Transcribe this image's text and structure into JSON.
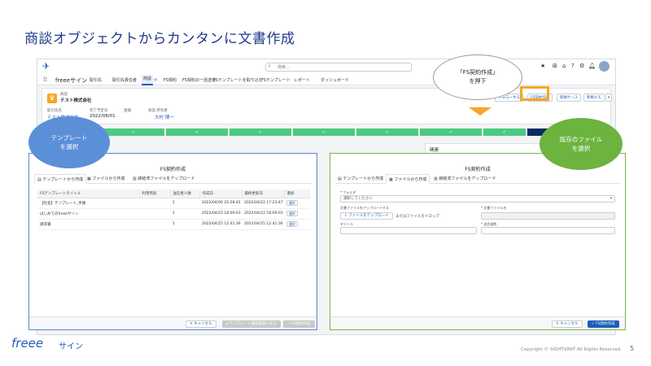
{
  "slide": {
    "title": "商談オブジェクトからカンタンに文書作成",
    "copyright": "Copyright © SIGHTVINIT All Rights Reserved.",
    "page_number": "5",
    "logo_text": "freee",
    "logo_sub": "サイン"
  },
  "topbar": {
    "app_name": "freeeサイン",
    "search_placeholder": "検索..."
  },
  "nav": {
    "tabs": [
      "取引先",
      "取引先責任者",
      "リード",
      "商談",
      "FS契約",
      "FS契約の一括送信",
      "FSテンプレートを取り込む",
      "FSテンプレート",
      "レポート",
      "ダッシュボード"
    ],
    "active_tab": "商談"
  },
  "record": {
    "type_label": "商談",
    "name": "テスト株式会社",
    "fields": [
      {
        "label": "取引先名",
        "value": "テスト株式会社"
      },
      {
        "label": "完了予定日",
        "value": "2022/08/01"
      },
      {
        "label": "金額",
        "value": ""
      },
      {
        "label": "商談 所有者",
        "value": "大村 博一"
      }
    ],
    "buttons": [
      "フォローする",
      "FS契約作成",
      "新規ケース",
      "新規メモ"
    ],
    "highlighted_button": "FS契約作成"
  },
  "path": {
    "last_step_label": "商談成立"
  },
  "callouts": {
    "button": "「FS契約作成」\nを押下",
    "template": "テンプレート\nを選択",
    "file": "既存のファイル\nを選択"
  },
  "left_dialog": {
    "title": "FS契約作成",
    "tabs": [
      "テンプレートから作成",
      "ファイルから作成",
      "締結済ファイルをアップロード"
    ],
    "active_tab": "テンプレートから作成",
    "columns": [
      "FSテンプレートタイトル",
      "利用用途",
      "送信者人数",
      "作成日",
      "最終更新日",
      "選択"
    ],
    "rows": [
      {
        "title": "【社名】テンプレート_手順",
        "use": "",
        "count": "1",
        "created": "2022/04/06 20:28:42",
        "updated": "2022/04/22 17:23:47",
        "action": "選択"
      },
      {
        "title": "はじめてのfreeeサイン",
        "use": "",
        "count": "1",
        "created": "2022/04/22 18:09:03",
        "updated": "2022/04/22 18:09:03",
        "action": "選択"
      },
      {
        "title": "請求書",
        "use": "",
        "count": "1",
        "created": "2022/04/25 12:41:36",
        "updated": "2022/04/25 12:41:36",
        "action": "選択"
      }
    ],
    "footer": {
      "cancel": "キャンセル",
      "back": "テンプレート選択画面へ戻る",
      "create": "FS契約作成"
    }
  },
  "right_dialog": {
    "title": "FS契約作成",
    "tabs": [
      "テンプレートから作成",
      "ファイルから作成",
      "締結済ファイルをアップロード"
    ],
    "active_tab": "ファイルから作成",
    "folder_label": "* フォルダ",
    "folder_placeholder": "選択してください",
    "upload_label": "文書ファイルをアップロードする",
    "upload_button": "ファイルをアップロード",
    "drop_text": "またはファイルをドロップ",
    "filename_label": "* 文書ファイル名",
    "title_label": "タイトル",
    "sender_label": "* 送信者数",
    "footer": {
      "cancel": "キャンセル",
      "create": "FS契約作成"
    }
  },
  "colors": {
    "title": "#1f3a8a",
    "highlight": "#f5a623",
    "left_border": "#5b86c9",
    "right_border": "#7ab648",
    "blue_callout": "#5b8fd8",
    "green_callout": "#6db33f",
    "path_green": "#4bca81"
  },
  "right_panel_header": "関連"
}
